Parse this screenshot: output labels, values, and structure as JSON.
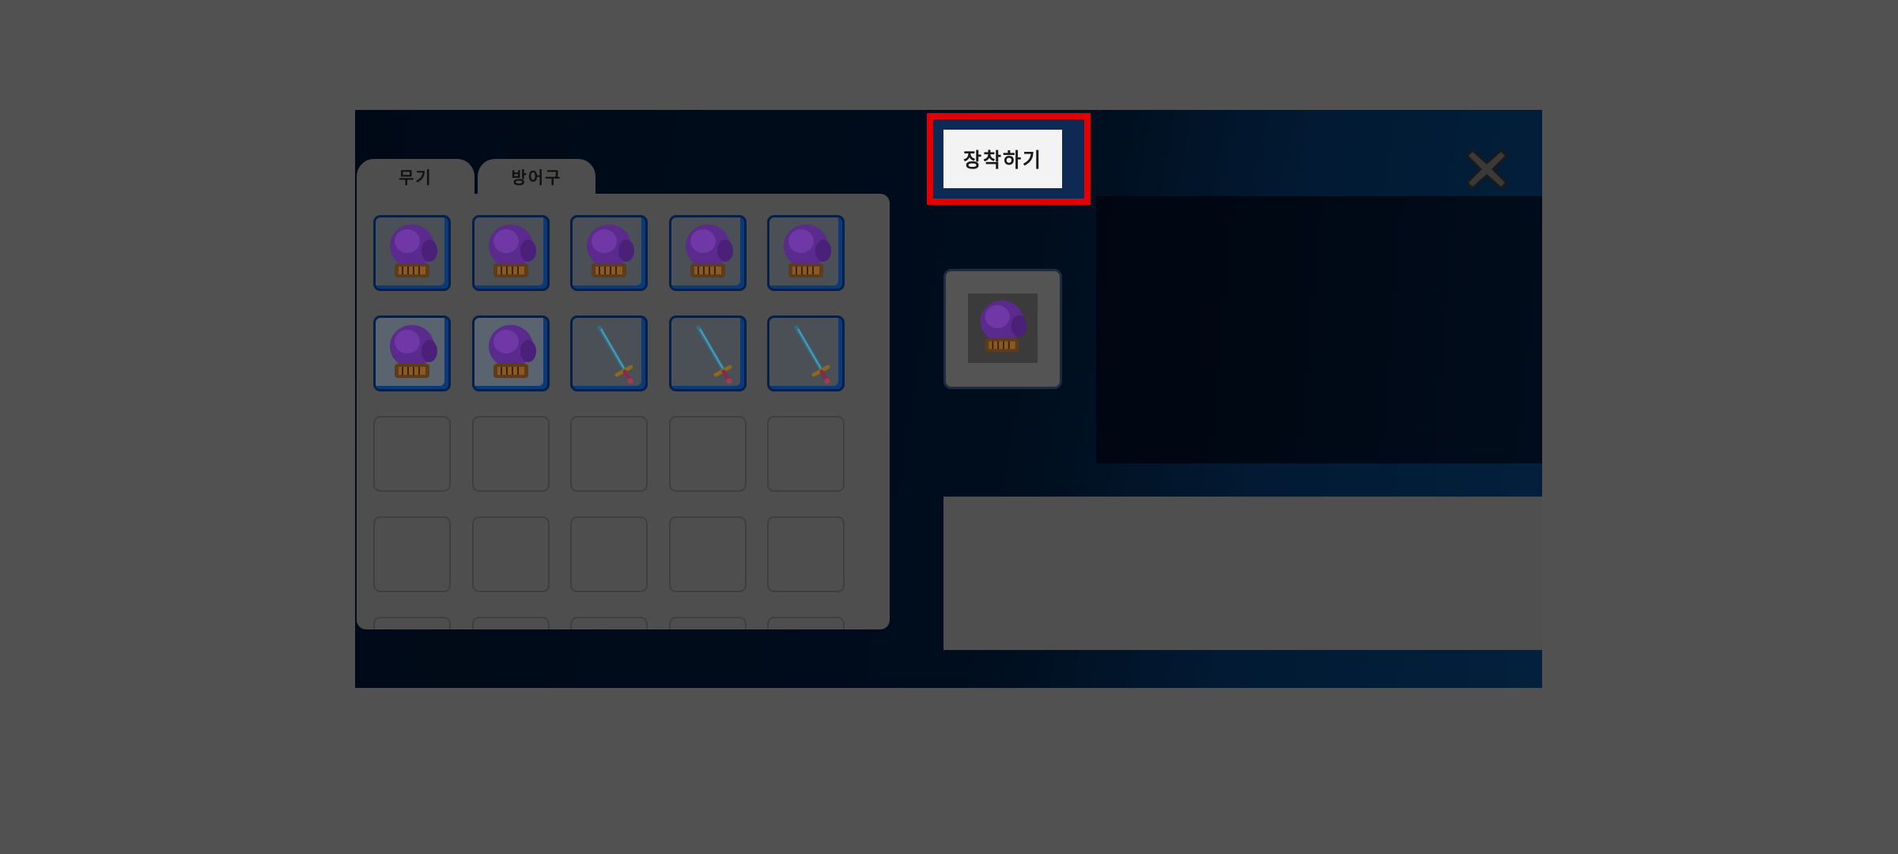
{
  "tabs": [
    {
      "label": "무기"
    },
    {
      "label": "방어구"
    }
  ],
  "equip_button": {
    "label": "장착하기"
  },
  "inventory": {
    "columns": 5,
    "visible_rows": 5,
    "items": [
      "boxing-glove-icon",
      "boxing-glove-icon",
      "boxing-glove-icon",
      "boxing-glove-icon",
      "boxing-glove-icon",
      "boxing-glove-icon",
      "boxing-glove-icon",
      "sword-icon",
      "sword-icon",
      "sword-icon"
    ]
  },
  "selected_item": {
    "icon": "boxing-glove-icon"
  },
  "colors": {
    "highlight": "#e00000",
    "glove": "#6a2fa0",
    "panel": "#000d1c"
  }
}
